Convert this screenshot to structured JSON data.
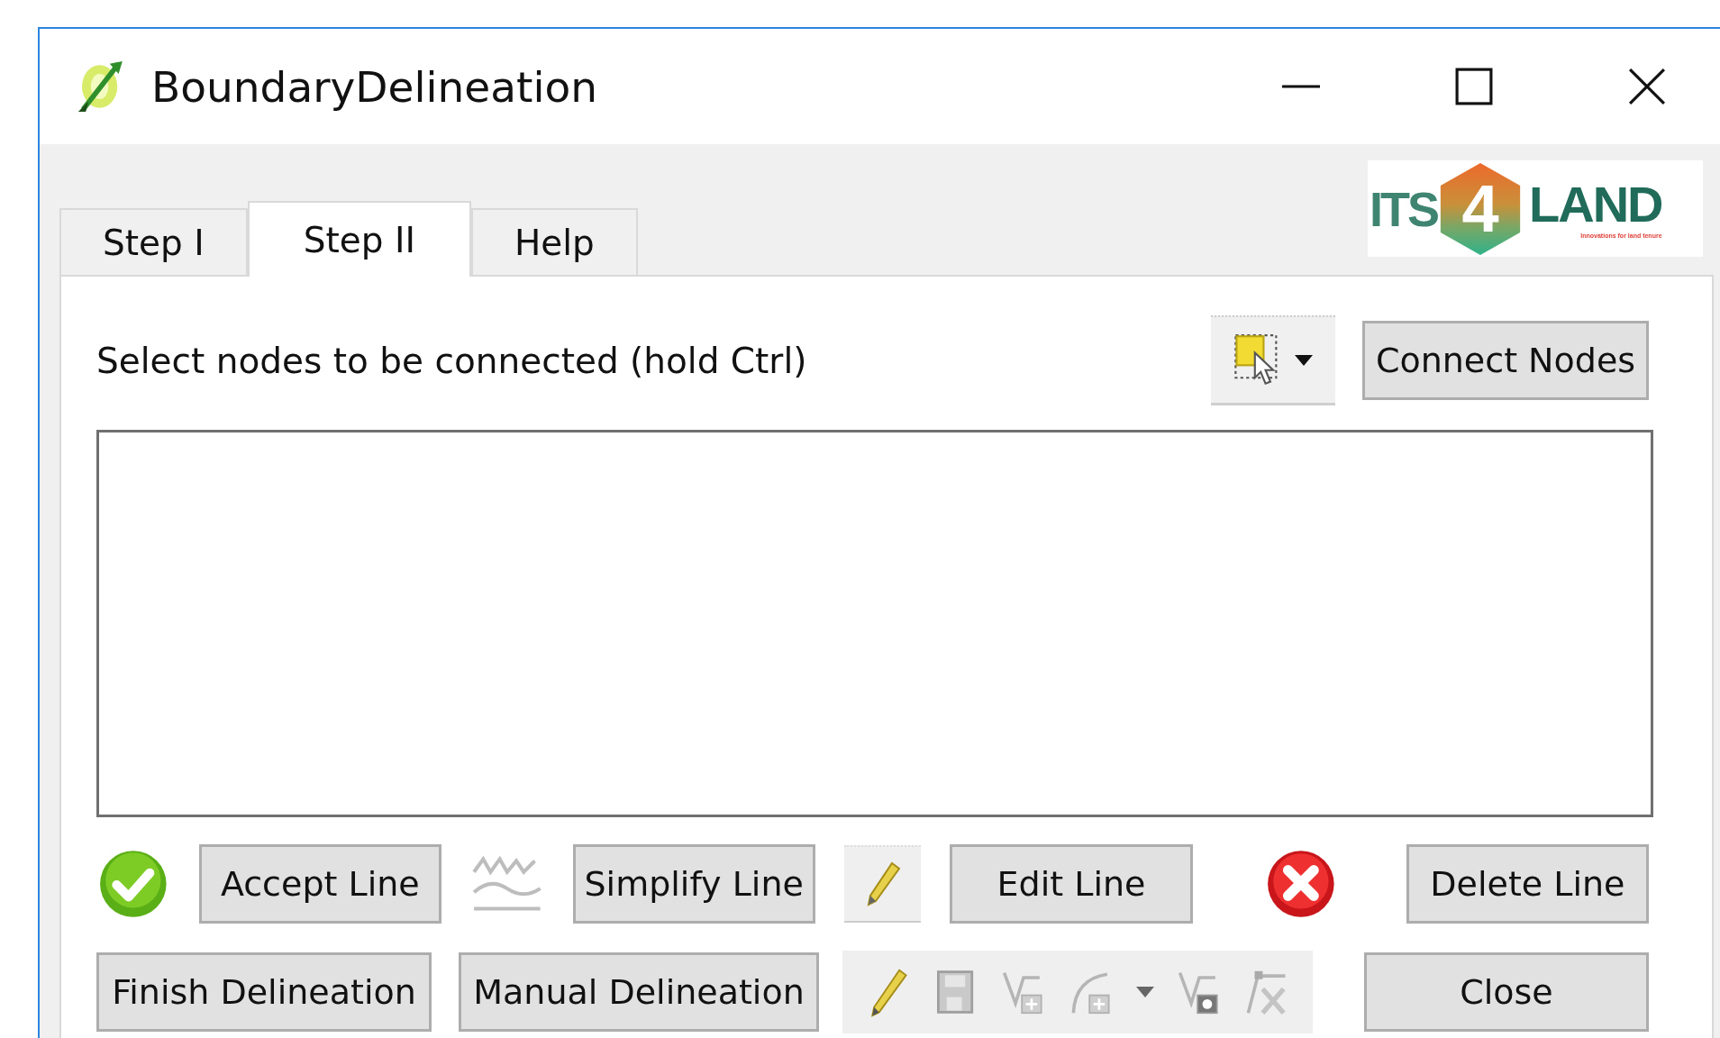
{
  "window": {
    "title": "BoundaryDelineation"
  },
  "logo": {
    "left": "ITS",
    "mark": "4",
    "right": "LAND",
    "tagline": "Innovations for land tenure"
  },
  "tabs": [
    {
      "label": "Step I",
      "selected": false
    },
    {
      "label": "Step II",
      "selected": true
    },
    {
      "label": "Help",
      "selected": false
    }
  ],
  "instruction": "Select nodes to be connected (hold Ctrl)",
  "connect_button": "Connect Nodes",
  "row_1_buttons": [
    "Accept Line",
    "Simplify Line",
    "Edit Line",
    "Delete Line"
  ],
  "row_2_buttons": [
    "Finish Delineation",
    "Manual Delineation",
    "Close"
  ]
}
